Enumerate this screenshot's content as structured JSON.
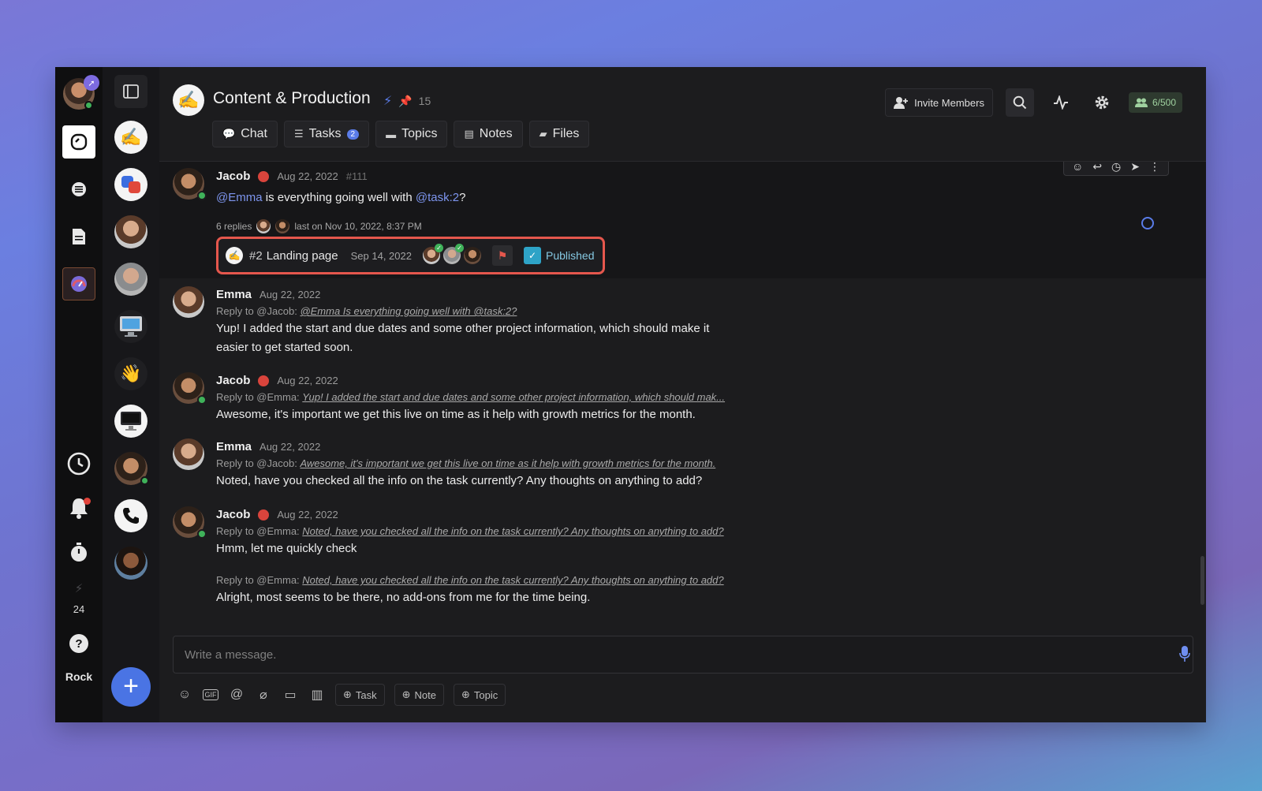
{
  "rail": {
    "count": "24",
    "brand": "Rock"
  },
  "header": {
    "title": "Content & Production",
    "pinned_count": "15",
    "invite_label": "Invite Members",
    "members_count": "6/500",
    "tabs": [
      {
        "label": "Chat",
        "icon": "chat-icon"
      },
      {
        "label": "Tasks",
        "icon": "tasks-icon",
        "badge": "2"
      },
      {
        "label": "Topics",
        "icon": "topics-icon"
      },
      {
        "label": "Notes",
        "icon": "notes-icon"
      },
      {
        "label": "Files",
        "icon": "files-icon"
      }
    ]
  },
  "messages": [
    {
      "author": "Jacob",
      "date": "Aug 22, 2022",
      "id": "#111",
      "mention": "@Emma",
      "text_mid": " is everything going well with ",
      "task_ref": "@task:2",
      "text_end": "?",
      "thread": {
        "replies": "6 replies",
        "last": "last on Nov 10, 2022, 8:37 PM"
      },
      "task": {
        "number": "#2",
        "title": "Landing page",
        "date": "Sep 14, 2022",
        "status": "Published"
      }
    },
    {
      "author": "Emma",
      "date": "Aug 22, 2022",
      "reply_to": "Reply to @Jacob:",
      "quote": "@Emma Is everything going well with @task:2?",
      "line1": "Yup! I added the start and due dates and some other project information, which should make it",
      "line2": "easier to get started soon."
    },
    {
      "author": "Jacob",
      "date": "Aug 22, 2022",
      "reply_to": "Reply to @Emma:",
      "quote": "Yup! I added the start and due dates and some other project information, which should mak...",
      "text": "Awesome, it's important we get this live on time as it help with growth metrics for the month."
    },
    {
      "author": "Emma",
      "date": "Aug 22, 2022",
      "reply_to": "Reply to @Jacob:",
      "quote": "Awesome, it's important we get this live on time as it help with growth metrics for the month.",
      "text": "Noted, have you checked all the info on the task currently? Any thoughts on anything to add?"
    },
    {
      "author": "Jacob",
      "date": "Aug 22, 2022",
      "reply_to": "Reply to @Emma:",
      "quote": "Noted, have you checked all the info on the task currently? Any thoughts on anything to add?",
      "text": "Hmm, let me quickly check",
      "followup_reply_to": "Reply to @Emma:",
      "followup_quote": "Noted, have you checked all the info on the task currently? Any thoughts on anything to add?",
      "followup_text": "Alright, most seems to be there, no add-ons from me for the time being."
    }
  ],
  "composer": {
    "placeholder": "Write a message.",
    "chips": [
      "Task",
      "Note",
      "Topic"
    ],
    "gif_label": "GIF"
  },
  "colors": {
    "accent": "#5a7ce8",
    "highlight_border": "#e5574d",
    "online": "#3fb25a"
  }
}
